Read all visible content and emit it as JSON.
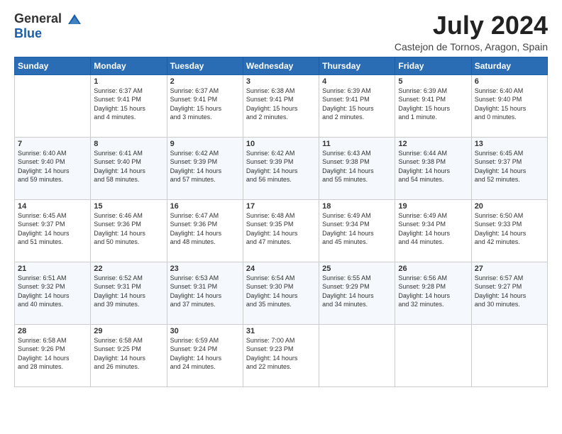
{
  "logo": {
    "line1": "General",
    "line2": "Blue"
  },
  "title": "July 2024",
  "location": "Castejon de Tornos, Aragon, Spain",
  "days_of_week": [
    "Sunday",
    "Monday",
    "Tuesday",
    "Wednesday",
    "Thursday",
    "Friday",
    "Saturday"
  ],
  "weeks": [
    [
      {
        "day": "",
        "info": ""
      },
      {
        "day": "1",
        "info": "Sunrise: 6:37 AM\nSunset: 9:41 PM\nDaylight: 15 hours\nand 4 minutes."
      },
      {
        "day": "2",
        "info": "Sunrise: 6:37 AM\nSunset: 9:41 PM\nDaylight: 15 hours\nand 3 minutes."
      },
      {
        "day": "3",
        "info": "Sunrise: 6:38 AM\nSunset: 9:41 PM\nDaylight: 15 hours\nand 2 minutes."
      },
      {
        "day": "4",
        "info": "Sunrise: 6:39 AM\nSunset: 9:41 PM\nDaylight: 15 hours\nand 2 minutes."
      },
      {
        "day": "5",
        "info": "Sunrise: 6:39 AM\nSunset: 9:41 PM\nDaylight: 15 hours\nand 1 minute."
      },
      {
        "day": "6",
        "info": "Sunrise: 6:40 AM\nSunset: 9:40 PM\nDaylight: 15 hours\nand 0 minutes."
      }
    ],
    [
      {
        "day": "7",
        "info": "Sunrise: 6:40 AM\nSunset: 9:40 PM\nDaylight: 14 hours\nand 59 minutes."
      },
      {
        "day": "8",
        "info": "Sunrise: 6:41 AM\nSunset: 9:40 PM\nDaylight: 14 hours\nand 58 minutes."
      },
      {
        "day": "9",
        "info": "Sunrise: 6:42 AM\nSunset: 9:39 PM\nDaylight: 14 hours\nand 57 minutes."
      },
      {
        "day": "10",
        "info": "Sunrise: 6:42 AM\nSunset: 9:39 PM\nDaylight: 14 hours\nand 56 minutes."
      },
      {
        "day": "11",
        "info": "Sunrise: 6:43 AM\nSunset: 9:38 PM\nDaylight: 14 hours\nand 55 minutes."
      },
      {
        "day": "12",
        "info": "Sunrise: 6:44 AM\nSunset: 9:38 PM\nDaylight: 14 hours\nand 54 minutes."
      },
      {
        "day": "13",
        "info": "Sunrise: 6:45 AM\nSunset: 9:37 PM\nDaylight: 14 hours\nand 52 minutes."
      }
    ],
    [
      {
        "day": "14",
        "info": "Sunrise: 6:45 AM\nSunset: 9:37 PM\nDaylight: 14 hours\nand 51 minutes."
      },
      {
        "day": "15",
        "info": "Sunrise: 6:46 AM\nSunset: 9:36 PM\nDaylight: 14 hours\nand 50 minutes."
      },
      {
        "day": "16",
        "info": "Sunrise: 6:47 AM\nSunset: 9:36 PM\nDaylight: 14 hours\nand 48 minutes."
      },
      {
        "day": "17",
        "info": "Sunrise: 6:48 AM\nSunset: 9:35 PM\nDaylight: 14 hours\nand 47 minutes."
      },
      {
        "day": "18",
        "info": "Sunrise: 6:49 AM\nSunset: 9:34 PM\nDaylight: 14 hours\nand 45 minutes."
      },
      {
        "day": "19",
        "info": "Sunrise: 6:49 AM\nSunset: 9:34 PM\nDaylight: 14 hours\nand 44 minutes."
      },
      {
        "day": "20",
        "info": "Sunrise: 6:50 AM\nSunset: 9:33 PM\nDaylight: 14 hours\nand 42 minutes."
      }
    ],
    [
      {
        "day": "21",
        "info": "Sunrise: 6:51 AM\nSunset: 9:32 PM\nDaylight: 14 hours\nand 40 minutes."
      },
      {
        "day": "22",
        "info": "Sunrise: 6:52 AM\nSunset: 9:31 PM\nDaylight: 14 hours\nand 39 minutes."
      },
      {
        "day": "23",
        "info": "Sunrise: 6:53 AM\nSunset: 9:31 PM\nDaylight: 14 hours\nand 37 minutes."
      },
      {
        "day": "24",
        "info": "Sunrise: 6:54 AM\nSunset: 9:30 PM\nDaylight: 14 hours\nand 35 minutes."
      },
      {
        "day": "25",
        "info": "Sunrise: 6:55 AM\nSunset: 9:29 PM\nDaylight: 14 hours\nand 34 minutes."
      },
      {
        "day": "26",
        "info": "Sunrise: 6:56 AM\nSunset: 9:28 PM\nDaylight: 14 hours\nand 32 minutes."
      },
      {
        "day": "27",
        "info": "Sunrise: 6:57 AM\nSunset: 9:27 PM\nDaylight: 14 hours\nand 30 minutes."
      }
    ],
    [
      {
        "day": "28",
        "info": "Sunrise: 6:58 AM\nSunset: 9:26 PM\nDaylight: 14 hours\nand 28 minutes."
      },
      {
        "day": "29",
        "info": "Sunrise: 6:58 AM\nSunset: 9:25 PM\nDaylight: 14 hours\nand 26 minutes."
      },
      {
        "day": "30",
        "info": "Sunrise: 6:59 AM\nSunset: 9:24 PM\nDaylight: 14 hours\nand 24 minutes."
      },
      {
        "day": "31",
        "info": "Sunrise: 7:00 AM\nSunset: 9:23 PM\nDaylight: 14 hours\nand 22 minutes."
      },
      {
        "day": "",
        "info": ""
      },
      {
        "day": "",
        "info": ""
      },
      {
        "day": "",
        "info": ""
      }
    ]
  ]
}
